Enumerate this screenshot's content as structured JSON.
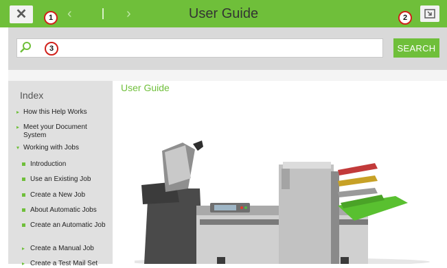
{
  "header": {
    "title": "User Guide",
    "close_glyph": "✕",
    "back_glyph": "‹",
    "forward_glyph": "›"
  },
  "markers": [
    "1",
    "2",
    "3"
  ],
  "search": {
    "value": "",
    "button_label": "SEARCH"
  },
  "sidebar": {
    "title": "Index",
    "items": [
      {
        "label": "How this Help Works"
      },
      {
        "label": "Meet your Document System"
      },
      {
        "label": "Working with Jobs"
      },
      {
        "label": "Introduction"
      },
      {
        "label": "Use an Existing Job"
      },
      {
        "label": "Create a New Job"
      },
      {
        "label": "About Automatic Jobs"
      },
      {
        "label": "Create an Automatic Job"
      },
      {
        "label": "Create a Manual Job"
      },
      {
        "label": "Create a Test Mail Set"
      }
    ]
  },
  "content": {
    "title": "User Guide"
  },
  "colors": {
    "brand_green": "#6fbf3a",
    "marker_red": "#d0201a"
  }
}
